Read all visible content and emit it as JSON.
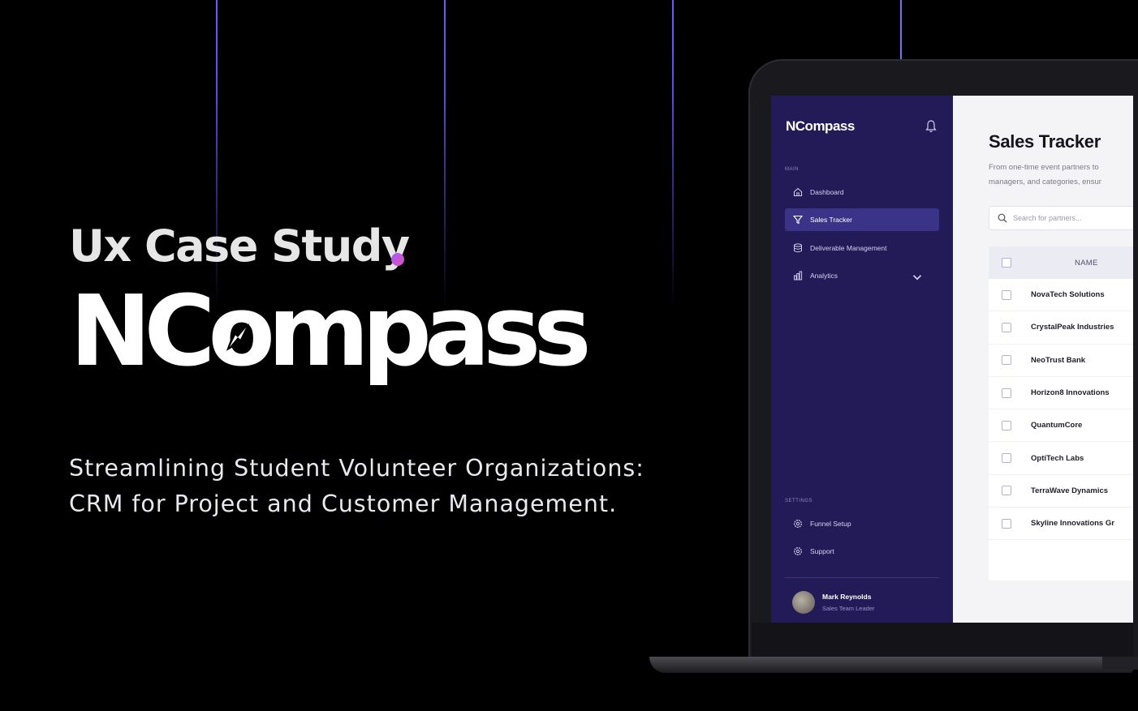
{
  "hero": {
    "eyebrow": "Ux Case Study",
    "brand": {
      "prefix": "NC",
      "o": "o",
      "suffix": "mpass"
    },
    "tagline_line1": "Streamlining Student Volunteer Organizations:",
    "tagline_line2": "CRM for Project and Customer Management.",
    "accent_dot_colors": [
      "#a45cff",
      "#e24db6"
    ]
  },
  "app": {
    "logo": "NCompass",
    "sidebar": {
      "main_section": "MAIN",
      "items": [
        {
          "label": "Dashboard",
          "icon": "home-icon"
        },
        {
          "label": "Sales Tracker",
          "icon": "filter-icon",
          "active": true
        },
        {
          "label": "Deliverable Management",
          "icon": "database-icon"
        },
        {
          "label": "Analytics",
          "icon": "chart-icon",
          "has_chevron": true
        }
      ],
      "settings_section": "SETTINGS",
      "settings_items": [
        {
          "label": "Funnel Setup",
          "icon": "gear-icon"
        },
        {
          "label": "Support",
          "icon": "gear-icon"
        }
      ],
      "user": {
        "name": "Mark Reynolds",
        "role": "Sales Team Leader"
      }
    },
    "main": {
      "title": "Sales Tracker",
      "description_line1": "From one-time event partners to",
      "description_line2": "managers, and categories, ensur",
      "search_placeholder": "Search for partners...",
      "table": {
        "column_name": "NAME",
        "rows": [
          "NovaTech Solutions",
          "CrystalPeak Industries",
          "NeoTrust Bank",
          "Horizon8 Innovations",
          "QuantumCore",
          "OptiTech Labs",
          "TerraWave Dynamics",
          "Skyline Innovations Gr"
        ]
      }
    },
    "colors": {
      "sidebar": "#221b57",
      "active_item": "#3b3388",
      "main_bg": "#f4f4f7"
    }
  }
}
